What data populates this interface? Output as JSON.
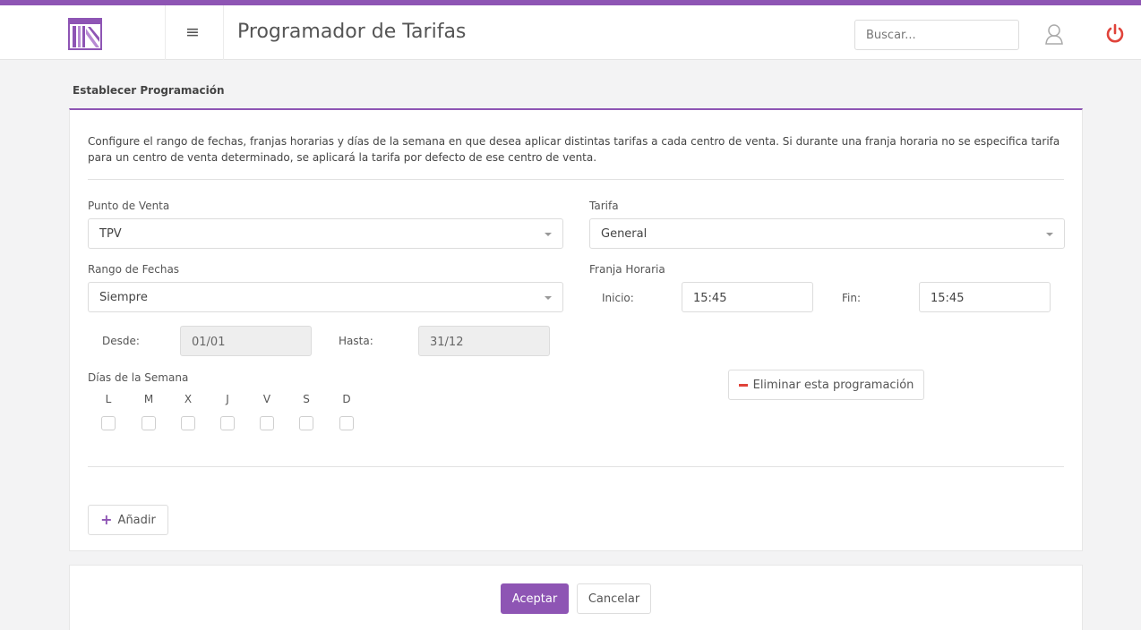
{
  "header": {
    "title": "Programador de Tarifas",
    "search_placeholder": "Buscar...",
    "menu_icon": "hamburger-icon",
    "user_icon": "user-icon",
    "power_icon": "power-icon",
    "logo_icon": "building-logo",
    "accent_color": "#8e55b4",
    "power_color": "#e0433a"
  },
  "section": {
    "title": "Establecer Programación",
    "description": "Configure el rango de fechas, franjas horarias y días de la semana en que desea aplicar distintas tarifas a cada centro de venta. Si durante una franja horaria no se especifica tarifa para un centro de venta determinado, se aplicará la tarifa por defecto de ese centro de venta."
  },
  "form": {
    "punto_venta_label": "Punto de Venta",
    "punto_venta_value": "TPV",
    "tarifa_label": "Tarifa",
    "tarifa_value": "General",
    "rango_label": "Rango de Fechas",
    "rango_value": "Siempre",
    "franja_label": "Franja Horaria",
    "inicio_label": "Inicio:",
    "inicio_value": "15:45",
    "fin_label": "Fin:",
    "fin_value": "15:45",
    "desde_label": "Desde:",
    "desde_value": "01/01",
    "hasta_label": "Hasta:",
    "hasta_value": "31/12",
    "dias_label": "Días de la Semana",
    "days": [
      "L",
      "M",
      "X",
      "J",
      "V",
      "S",
      "D"
    ],
    "days_checked": [
      false,
      false,
      false,
      false,
      false,
      false,
      false
    ],
    "delete_label": "Eliminar esta programación",
    "add_label": "Añadir"
  },
  "footer": {
    "accept_label": "Aceptar",
    "cancel_label": "Cancelar"
  }
}
